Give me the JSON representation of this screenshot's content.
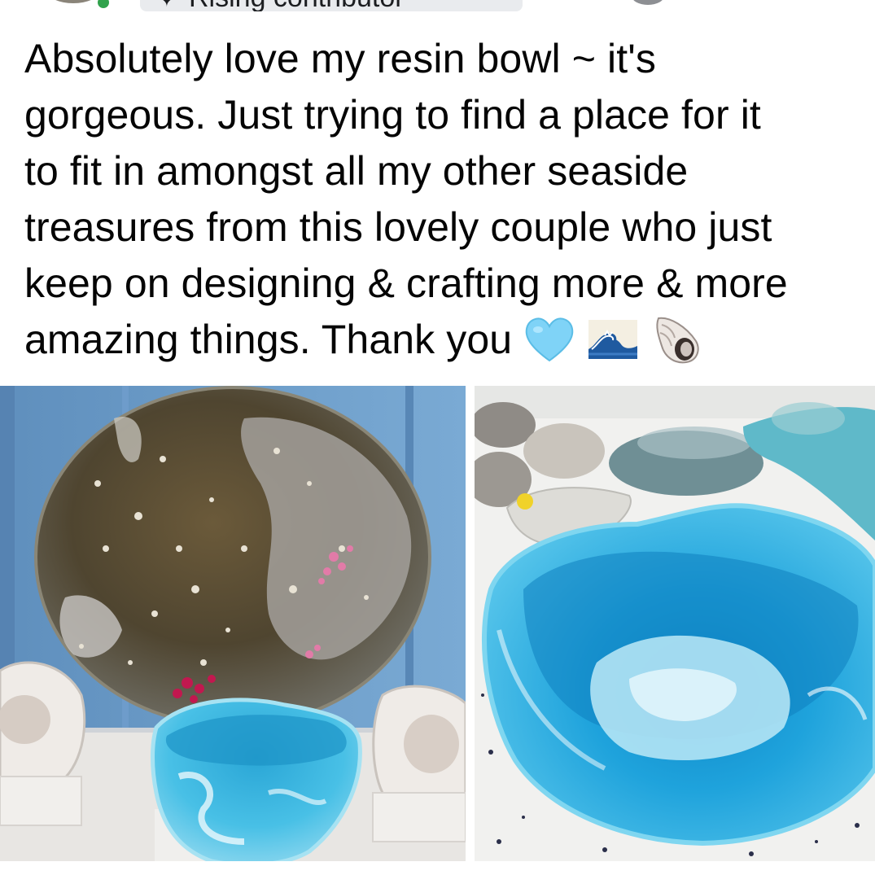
{
  "header": {
    "badge_label": "Rising contributor",
    "badge_icon": "sparkle-icon",
    "online_color": "#31a24c"
  },
  "post": {
    "lines": [
      "Absolutely love my resin bowl ~ it's",
      "gorgeous. Just trying to find a place for it",
      "to fit in amongst all my other seaside",
      "treasures from this lovely couple who just",
      "keep on designing & crafting more & more",
      "amazing things. Thank you"
    ],
    "emojis": [
      "light-blue-heart-icon",
      "water-wave-icon",
      "spiral-shell-icon"
    ]
  },
  "photos": {
    "left": "resin-platter-and-bowl-photo",
    "right": "turquoise-resin-bowl-closeup-photo"
  },
  "colors": {
    "text": "#050505",
    "resin_blue": "#2bb3da",
    "wall_blue": "#6a9ec8"
  }
}
